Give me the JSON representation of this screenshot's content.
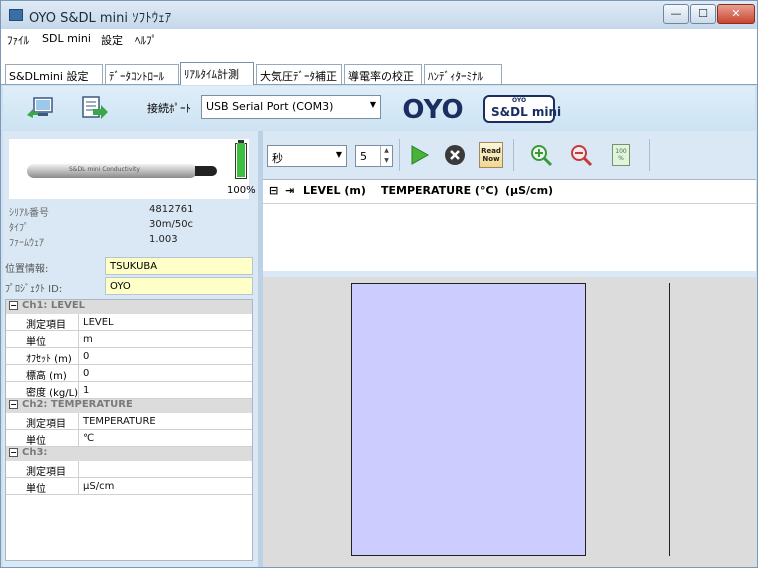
{
  "window": {
    "title": "OYO S&DL mini ｿﾌﾄｳｪｱ",
    "controls": {
      "minimize": "—",
      "maximize": "☐",
      "close": "✕"
    }
  },
  "menu": [
    "ﾌｧｲﾙ",
    "SDL mini",
    "設定",
    "ﾍﾙﾌﾟ"
  ],
  "tabs": [
    {
      "label": "S&DLmini 設定",
      "active": false
    },
    {
      "label": "ﾃﾞｰﾀｺﾝﾄﾛｰﾙ",
      "active": false
    },
    {
      "label": "ﾘｱﾙﾀｲﾑ計測",
      "active": true
    },
    {
      "label": "大気圧ﾃﾞｰﾀ補正",
      "active": false
    },
    {
      "label": "導電率の校正",
      "active": false
    },
    {
      "label": "ﾊﾝﾃﾞｨﾀｰﾐﾅﾙ",
      "active": false
    }
  ],
  "toolbar": {
    "connect_icon": "connect-icon",
    "export_icon": "export-icon",
    "port_label": "接続ﾎﾟｰﾄ",
    "port_value": "USB Serial Port (COM3)",
    "logo_text": "OYO",
    "product_logo_top": "OYO",
    "product_logo": "S&DL mini"
  },
  "device": {
    "probe_text": "S&DL mini Conductivity",
    "battery_percent": "100%",
    "battery_level": 1.0,
    "info": [
      {
        "key": "ｼﾘｱﾙ番号",
        "value": "4812761"
      },
      {
        "key": "ﾀｲﾌﾟ",
        "value": "30m/50c"
      },
      {
        "key": "ﾌｧｰﾑｳｪｱ",
        "value": "1.003"
      }
    ],
    "location_label": "位置情報:",
    "location_value": "TSUKUBA",
    "project_label": "ﾌﾟﾛｼﾞｪｸﾄ ID:",
    "project_value": "OYO"
  },
  "channels": [
    {
      "header": "Ch1: LEVEL",
      "rows": [
        {
          "key": "測定項目",
          "value": "LEVEL"
        },
        {
          "key": "単位",
          "value": "m"
        },
        {
          "key": "ｵﾌｾｯﾄ (m)",
          "value": "0"
        },
        {
          "key": "標高 (m)",
          "value": "0"
        },
        {
          "key": "密度 (kg/L)",
          "value": "1"
        }
      ]
    },
    {
      "header": "Ch2: TEMPERATURE",
      "rows": [
        {
          "key": "測定項目",
          "value": "TEMPERATURE"
        },
        {
          "key": "単位",
          "value": "℃"
        }
      ]
    },
    {
      "header": "Ch3:",
      "rows": [
        {
          "key": "測定項目",
          "value": ""
        },
        {
          "key": "単位",
          "value": "μS/cm"
        }
      ]
    }
  ],
  "measure": {
    "interval_unit": "秒",
    "interval_value": "5",
    "read_now": "Read Now",
    "pct_icon": "100 %",
    "columns": [
      "LEVEL (m)",
      "TEMPERATURE (°C)",
      "(μS/cm)"
    ]
  },
  "colors": {
    "chart_bar": "#ccccff",
    "chart_bg": "#dcdcdc",
    "field_highlight": "#ffffc8"
  }
}
